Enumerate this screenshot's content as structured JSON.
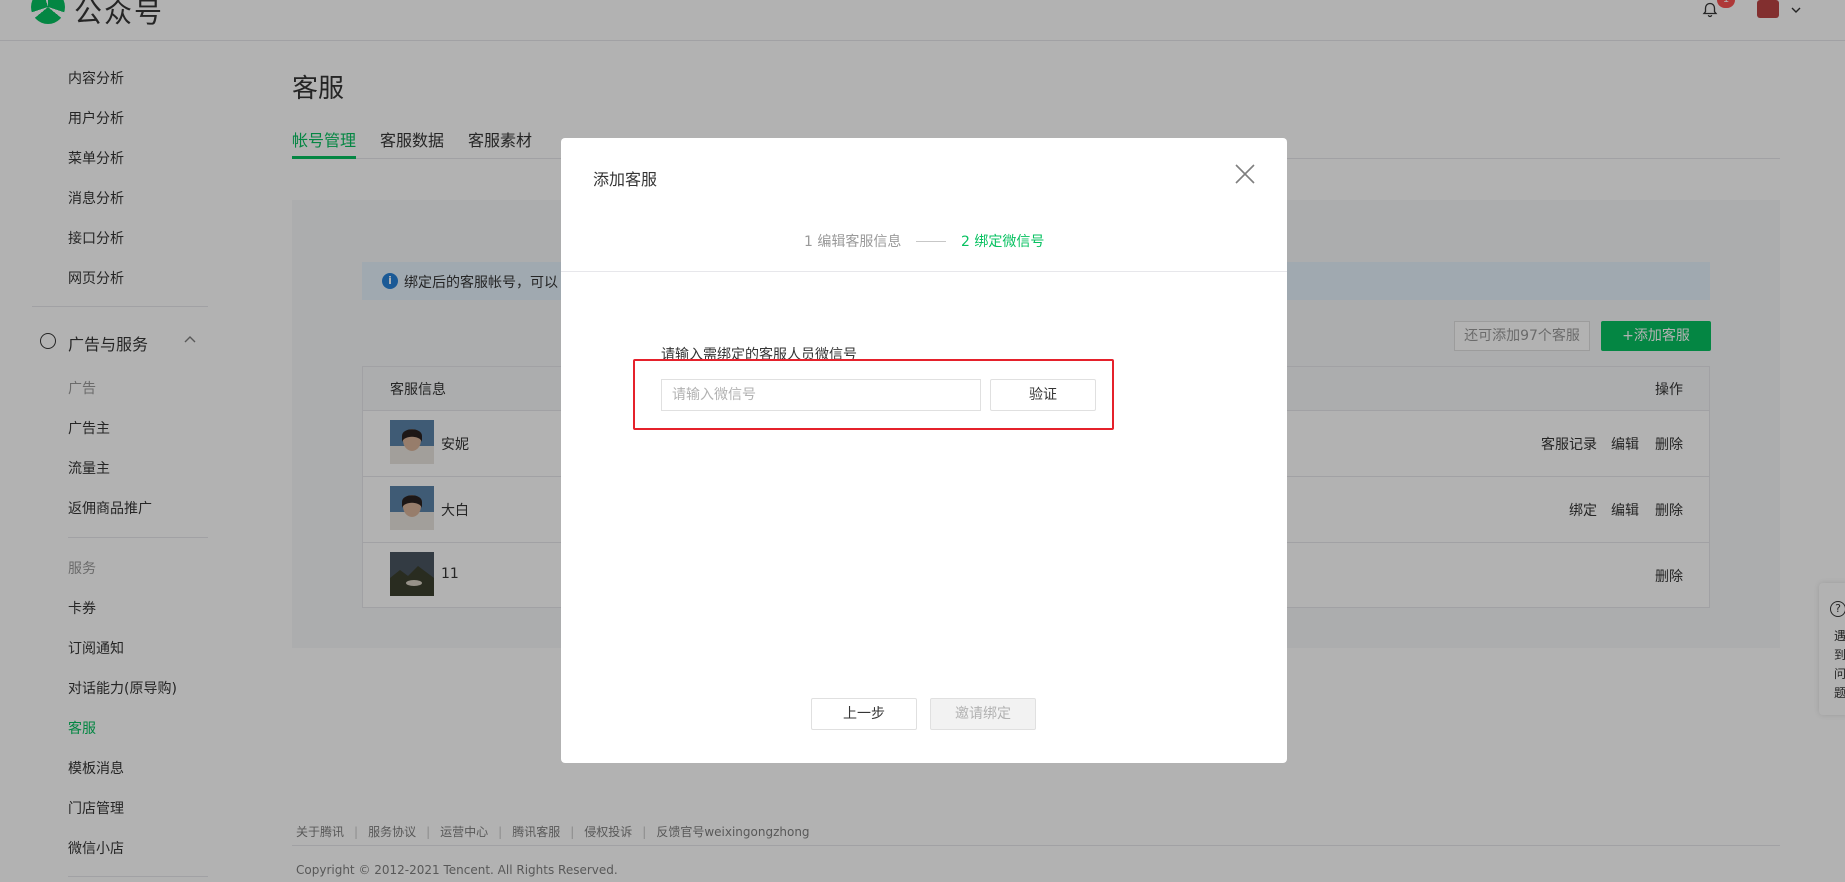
{
  "topbar": {
    "logo_text": "公众号",
    "notification_count": "1"
  },
  "sidebar": {
    "analysis_items": [
      {
        "label": "内容分析"
      },
      {
        "label": "用户分析"
      },
      {
        "label": "菜单分析"
      },
      {
        "label": "消息分析"
      },
      {
        "label": "接口分析"
      },
      {
        "label": "网页分析"
      }
    ],
    "group_label": "广告与服务",
    "ads_category": "广告",
    "ads_items": [
      {
        "label": "广告主"
      },
      {
        "label": "流量主"
      },
      {
        "label": "返佣商品推广"
      }
    ],
    "services_category": "服务",
    "service_items": [
      {
        "label": "卡券"
      },
      {
        "label": "订阅通知"
      },
      {
        "label": "对话能力(原导购)"
      },
      {
        "label": "客服"
      },
      {
        "label": "模板消息"
      },
      {
        "label": "门店管理"
      },
      {
        "label": "微信小店"
      }
    ]
  },
  "main": {
    "title": "客服",
    "tabs": [
      {
        "label": "帐号管理"
      },
      {
        "label": "客服数据"
      },
      {
        "label": "客服素材"
      }
    ],
    "notice_text": "绑定后的客服帐号，可以",
    "quota_text": "还可添加97个客服",
    "add_button": "+添加客服",
    "table": {
      "col_info": "客服信息",
      "col_ops": "操作",
      "rows": [
        {
          "name": "安妮",
          "ops": [
            "客服记录",
            "编辑",
            "删除"
          ]
        },
        {
          "name": "大白",
          "ops": [
            "绑定",
            "编辑",
            "删除"
          ]
        },
        {
          "name": "11",
          "ops": [
            "删除"
          ]
        }
      ]
    }
  },
  "footer": {
    "links": [
      "关于腾讯",
      "服务协议",
      "运营中心",
      "腾讯客服",
      "侵权投诉",
      "反馈官号weixingongzhong"
    ],
    "copyright": "Copyright © 2012-2021 Tencent. All Rights Reserved."
  },
  "feedback": {
    "text": "遇到问题"
  },
  "dialog": {
    "title": "添加客服",
    "step1": "1 编辑客服信息",
    "step2": "2 绑定微信号",
    "field_label": "请输入需绑定的客服人员微信号",
    "input_placeholder": "请输入微信号",
    "input_value": "",
    "verify_button": "验证",
    "prev_button": "上一步",
    "invite_button": "邀请绑定"
  },
  "colors": {
    "accent": "#07c160",
    "highlight_box": "#e5212b",
    "notice_bg": "#e5f2fd"
  }
}
